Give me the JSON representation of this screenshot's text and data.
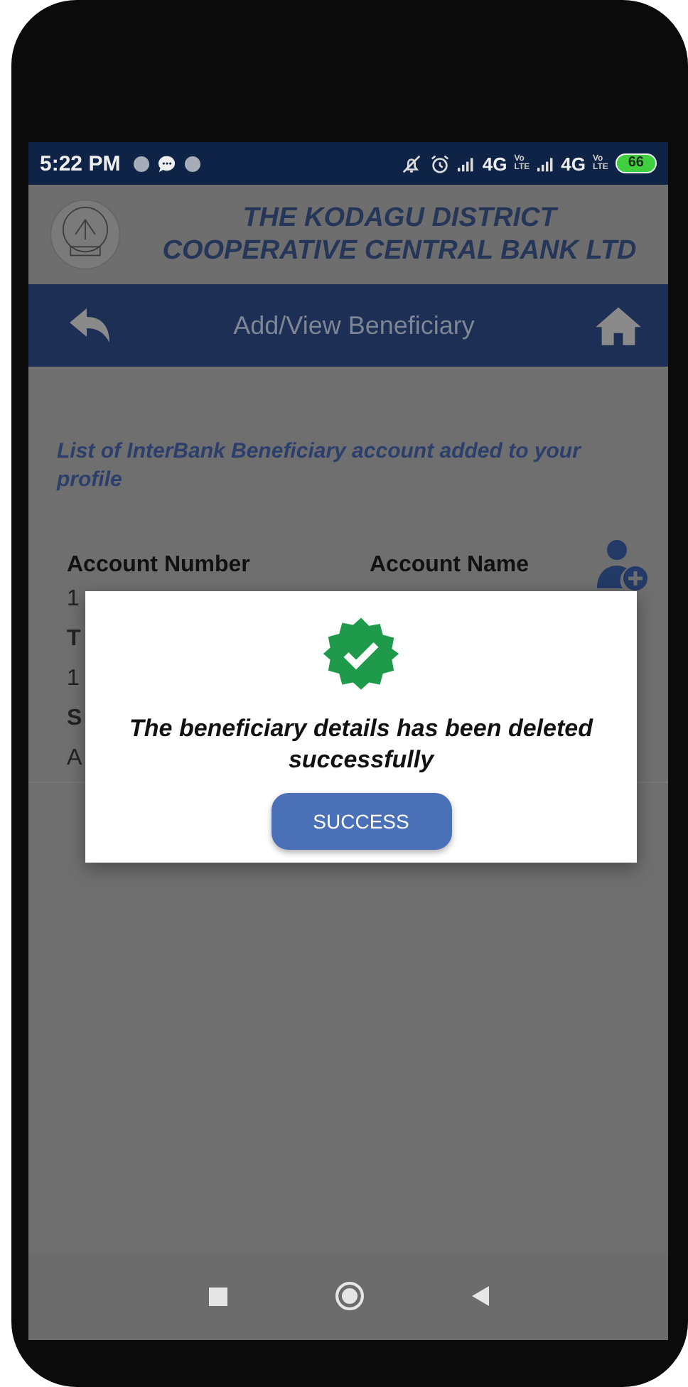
{
  "status_bar": {
    "time": "5:22 PM",
    "networks": [
      {
        "label": "4G",
        "badge_top": "Vo",
        "badge_bottom": "LTE"
      },
      {
        "label": "4G",
        "badge_top": "Vo",
        "badge_bottom": "LTE"
      }
    ],
    "battery": "66"
  },
  "header": {
    "bank_name_lines": [
      "THE KODAGU DISTRICT",
      "COOPERATIVE CENTRAL BANK LTD"
    ]
  },
  "nav": {
    "title": "Add/View Beneficiary"
  },
  "intro": "List of InterBank Beneficiary account added to your profile",
  "table": {
    "columns": [
      "Account Number",
      "Account Name"
    ],
    "partial_lines": [
      "1",
      "T",
      "1",
      "S",
      "A"
    ]
  },
  "dialog": {
    "message": "The beneficiary details has been deleted successfully",
    "button": "SUCCESS"
  }
}
